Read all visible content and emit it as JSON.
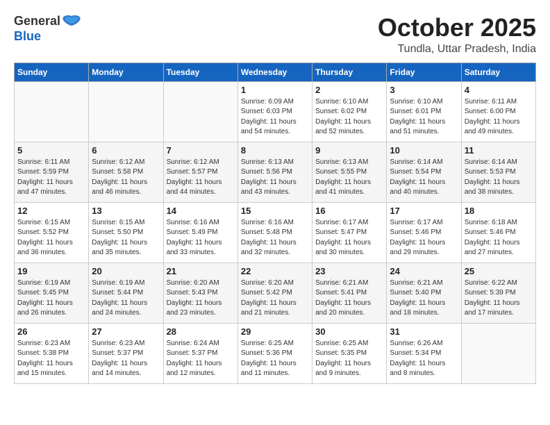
{
  "logo": {
    "general": "General",
    "blue": "Blue"
  },
  "title": "October 2025",
  "location": "Tundla, Uttar Pradesh, India",
  "days_of_week": [
    "Sunday",
    "Monday",
    "Tuesday",
    "Wednesday",
    "Thursday",
    "Friday",
    "Saturday"
  ],
  "weeks": [
    [
      {
        "day": "",
        "info": ""
      },
      {
        "day": "",
        "info": ""
      },
      {
        "day": "",
        "info": ""
      },
      {
        "day": "1",
        "info": "Sunrise: 6:09 AM\nSunset: 6:03 PM\nDaylight: 11 hours\nand 54 minutes."
      },
      {
        "day": "2",
        "info": "Sunrise: 6:10 AM\nSunset: 6:02 PM\nDaylight: 11 hours\nand 52 minutes."
      },
      {
        "day": "3",
        "info": "Sunrise: 6:10 AM\nSunset: 6:01 PM\nDaylight: 11 hours\nand 51 minutes."
      },
      {
        "day": "4",
        "info": "Sunrise: 6:11 AM\nSunset: 6:00 PM\nDaylight: 11 hours\nand 49 minutes."
      }
    ],
    [
      {
        "day": "5",
        "info": "Sunrise: 6:11 AM\nSunset: 5:59 PM\nDaylight: 11 hours\nand 47 minutes."
      },
      {
        "day": "6",
        "info": "Sunrise: 6:12 AM\nSunset: 5:58 PM\nDaylight: 11 hours\nand 46 minutes."
      },
      {
        "day": "7",
        "info": "Sunrise: 6:12 AM\nSunset: 5:57 PM\nDaylight: 11 hours\nand 44 minutes."
      },
      {
        "day": "8",
        "info": "Sunrise: 6:13 AM\nSunset: 5:56 PM\nDaylight: 11 hours\nand 43 minutes."
      },
      {
        "day": "9",
        "info": "Sunrise: 6:13 AM\nSunset: 5:55 PM\nDaylight: 11 hours\nand 41 minutes."
      },
      {
        "day": "10",
        "info": "Sunrise: 6:14 AM\nSunset: 5:54 PM\nDaylight: 11 hours\nand 40 minutes."
      },
      {
        "day": "11",
        "info": "Sunrise: 6:14 AM\nSunset: 5:53 PM\nDaylight: 11 hours\nand 38 minutes."
      }
    ],
    [
      {
        "day": "12",
        "info": "Sunrise: 6:15 AM\nSunset: 5:52 PM\nDaylight: 11 hours\nand 36 minutes."
      },
      {
        "day": "13",
        "info": "Sunrise: 6:15 AM\nSunset: 5:50 PM\nDaylight: 11 hours\nand 35 minutes."
      },
      {
        "day": "14",
        "info": "Sunrise: 6:16 AM\nSunset: 5:49 PM\nDaylight: 11 hours\nand 33 minutes."
      },
      {
        "day": "15",
        "info": "Sunrise: 6:16 AM\nSunset: 5:48 PM\nDaylight: 11 hours\nand 32 minutes."
      },
      {
        "day": "16",
        "info": "Sunrise: 6:17 AM\nSunset: 5:47 PM\nDaylight: 11 hours\nand 30 minutes."
      },
      {
        "day": "17",
        "info": "Sunrise: 6:17 AM\nSunset: 5:46 PM\nDaylight: 11 hours\nand 29 minutes."
      },
      {
        "day": "18",
        "info": "Sunrise: 6:18 AM\nSunset: 5:46 PM\nDaylight: 11 hours\nand 27 minutes."
      }
    ],
    [
      {
        "day": "19",
        "info": "Sunrise: 6:19 AM\nSunset: 5:45 PM\nDaylight: 11 hours\nand 26 minutes."
      },
      {
        "day": "20",
        "info": "Sunrise: 6:19 AM\nSunset: 5:44 PM\nDaylight: 11 hours\nand 24 minutes."
      },
      {
        "day": "21",
        "info": "Sunrise: 6:20 AM\nSunset: 5:43 PM\nDaylight: 11 hours\nand 23 minutes."
      },
      {
        "day": "22",
        "info": "Sunrise: 6:20 AM\nSunset: 5:42 PM\nDaylight: 11 hours\nand 21 minutes."
      },
      {
        "day": "23",
        "info": "Sunrise: 6:21 AM\nSunset: 5:41 PM\nDaylight: 11 hours\nand 20 minutes."
      },
      {
        "day": "24",
        "info": "Sunrise: 6:21 AM\nSunset: 5:40 PM\nDaylight: 11 hours\nand 18 minutes."
      },
      {
        "day": "25",
        "info": "Sunrise: 6:22 AM\nSunset: 5:39 PM\nDaylight: 11 hours\nand 17 minutes."
      }
    ],
    [
      {
        "day": "26",
        "info": "Sunrise: 6:23 AM\nSunset: 5:38 PM\nDaylight: 11 hours\nand 15 minutes."
      },
      {
        "day": "27",
        "info": "Sunrise: 6:23 AM\nSunset: 5:37 PM\nDaylight: 11 hours\nand 14 minutes."
      },
      {
        "day": "28",
        "info": "Sunrise: 6:24 AM\nSunset: 5:37 PM\nDaylight: 11 hours\nand 12 minutes."
      },
      {
        "day": "29",
        "info": "Sunrise: 6:25 AM\nSunset: 5:36 PM\nDaylight: 11 hours\nand 11 minutes."
      },
      {
        "day": "30",
        "info": "Sunrise: 6:25 AM\nSunset: 5:35 PM\nDaylight: 11 hours\nand 9 minutes."
      },
      {
        "day": "31",
        "info": "Sunrise: 6:26 AM\nSunset: 5:34 PM\nDaylight: 11 hours\nand 8 minutes."
      },
      {
        "day": "",
        "info": ""
      }
    ]
  ]
}
